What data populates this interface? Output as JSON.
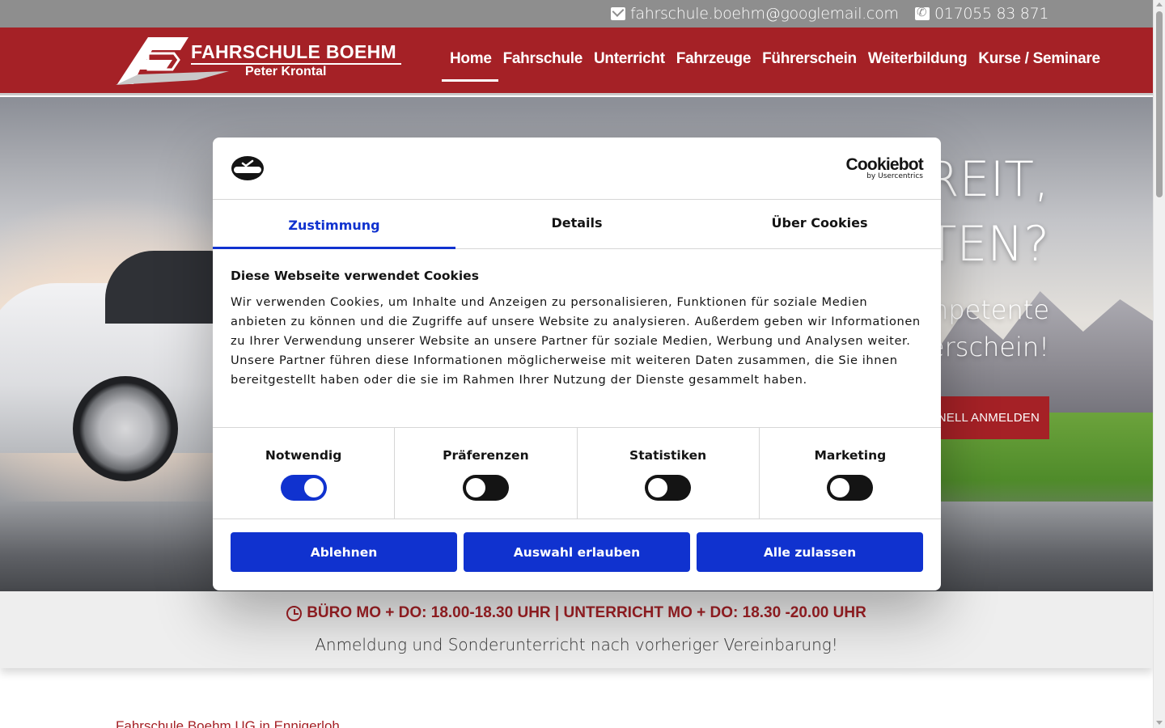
{
  "topbar": {
    "email": "fahrschule.boehm@googlemail.com",
    "phone": "017055 83 871"
  },
  "logo": {
    "title": "FAHRSCHULE BOEHM",
    "subtitle": "Peter Krontal"
  },
  "nav": {
    "items": [
      "Home",
      "Fahrschule",
      "Unterricht",
      "Fahrzeuge",
      "Führerschein",
      "Weiterbildung",
      "Kurse / Seminare"
    ],
    "active": "Home"
  },
  "hero": {
    "heading_line1": "REIT,",
    "heading_line2": "TEN?",
    "text_line1": "mpetente",
    "text_line2": "rerschein!",
    "button": "NELL ANMELDEN"
  },
  "info": {
    "hours": "BÜRO MO + DO: 18.00-18.30 UHR | UNTERRICHT MO + DO: 18.30 -20.00 UHR",
    "note": "Anmeldung und Sonderunterricht nach vorheriger Vereinbarung!"
  },
  "below_text": "Fahrschule Boehm UG in Ennigerloh",
  "cookie": {
    "brand": "Cookiebot",
    "brand_by": "by Usercentrics",
    "tabs": [
      "Zustimmung",
      "Details",
      "Über Cookies"
    ],
    "active_tab": "Zustimmung",
    "heading": "Diese Webseite verwendet Cookies",
    "body": "Wir verwenden Cookies, um Inhalte und Anzeigen zu personalisieren, Funktionen für soziale Medien anbieten zu können und die Zugriffe auf unsere Website zu analysieren. Außerdem geben wir Informationen zu Ihrer Verwendung unserer Website an unsere Partner für soziale Medien, Werbung und Analysen weiter. Unsere Partner führen diese Informationen möglicherweise mit weiteren Daten zusammen, die Sie ihnen bereitgestellt haben oder die sie im Rahmen Ihrer Nutzung der Dienste gesammelt haben.",
    "toggles": [
      {
        "label": "Notwendig",
        "on": true
      },
      {
        "label": "Präferenzen",
        "on": false
      },
      {
        "label": "Statistiken",
        "on": false
      },
      {
        "label": "Marketing",
        "on": false
      }
    ],
    "buttons": [
      "Ablehnen",
      "Auswahl erlauben",
      "Alle zulassen"
    ],
    "accent_color": "#1032cf"
  },
  "colors": {
    "brand_red": "#a52126",
    "topbar_gray": "#8e8e8e"
  }
}
